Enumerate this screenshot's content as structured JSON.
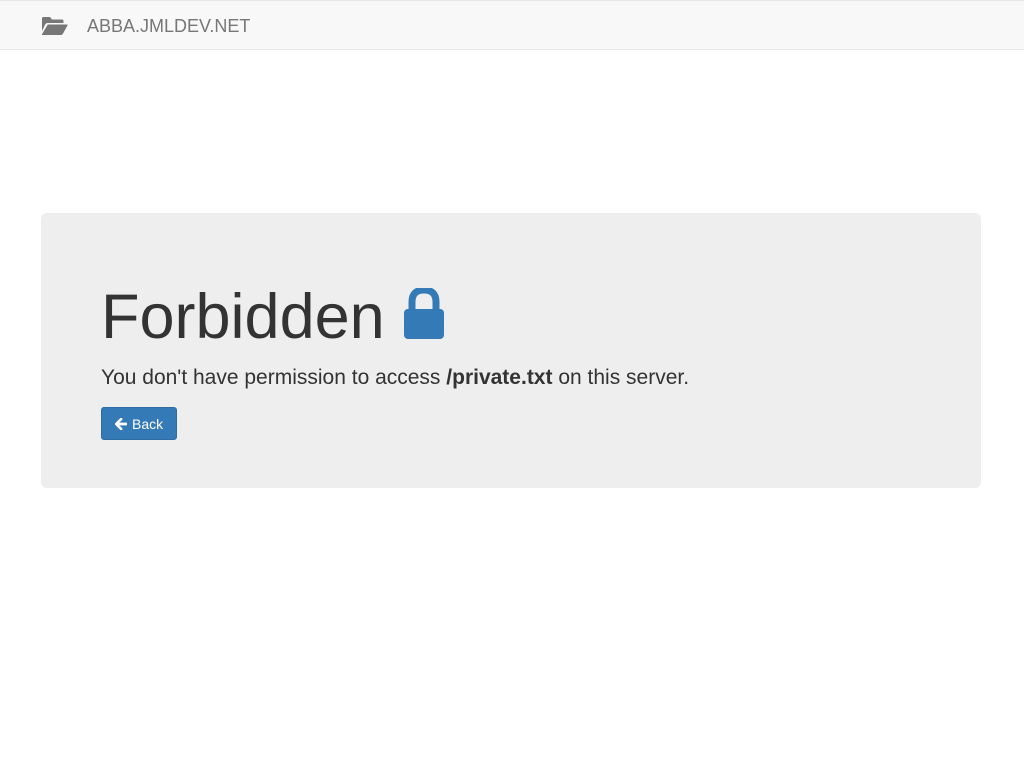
{
  "navbar": {
    "brand_icon": "folder-open-icon",
    "brand_text": "ABBA.JMLDEV.NET"
  },
  "jumbotron": {
    "heading": "Forbidden",
    "heading_icon": "lock-icon",
    "message_prefix": "You don't have permission to access ",
    "message_path": "/private.txt",
    "message_suffix": " on this server.",
    "back_button": {
      "icon": "arrow-left-icon",
      "label": "Back"
    }
  },
  "colors": {
    "accent": "#337ab7",
    "navbar_bg": "#f8f8f8",
    "jumbotron_bg": "#eeeeee",
    "brand_text": "#777777",
    "body_text": "#333333"
  }
}
